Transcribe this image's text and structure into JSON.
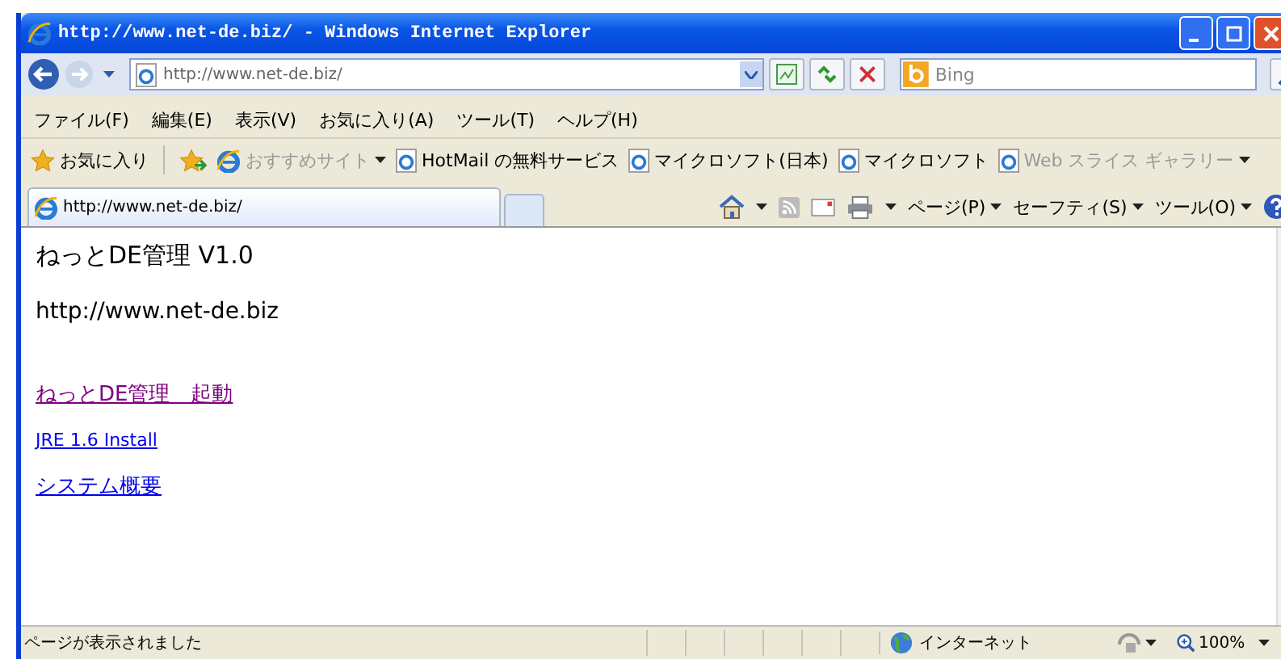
{
  "window": {
    "title": "http://www.net-de.biz/ - Windows Internet Explorer"
  },
  "address_bar": {
    "value": "http://www.net-de.biz/"
  },
  "search": {
    "placeholder": "Bing"
  },
  "menu": [
    "ファイル(F)",
    "編集(E)",
    "表示(V)",
    "お気に入り(A)",
    "ツール(T)",
    "ヘルプ(H)"
  ],
  "favorites_bar": {
    "label": "お気に入り",
    "items": [
      {
        "label": "おすすめサイト",
        "disabled": true,
        "has_menu": true
      },
      {
        "label": "HotMail の無料サービス",
        "disabled": false,
        "has_menu": false
      },
      {
        "label": "マイクロソフト(日本)",
        "disabled": false,
        "has_menu": false
      },
      {
        "label": "マイクロソフト",
        "disabled": false,
        "has_menu": false
      },
      {
        "label": "Web スライス ギャラリー",
        "disabled": true,
        "has_menu": true
      }
    ]
  },
  "tabs": [
    {
      "label": "http://www.net-de.biz/",
      "selected": true
    }
  ],
  "command_bar": [
    "ページ(P)",
    "セーフティ(S)",
    "ツール(O)"
  ],
  "page": {
    "heading": "ねっとDE管理 V1.0",
    "url_text": "http://www.net-de.biz",
    "links": [
      {
        "text": "ねっとDE管理　起動",
        "visited": true
      },
      {
        "text": "JRE 1.6 Install",
        "visited": false
      },
      {
        "text": "システム概要",
        "visited": false
      }
    ]
  },
  "status_bar": {
    "text": "ページが表示されました",
    "zone": "インターネット",
    "zoom": "100%"
  }
}
